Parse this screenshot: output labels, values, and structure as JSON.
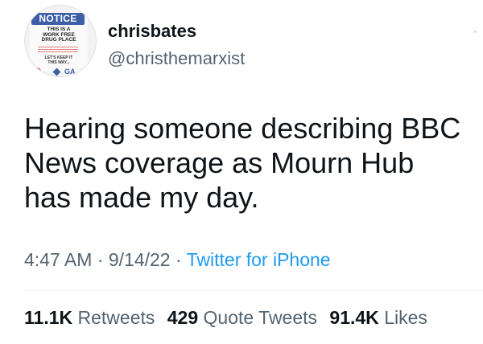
{
  "avatar": {
    "icon": "notice-sign-avatar-icon",
    "sign_title": "NOTICE",
    "sign_lines": [
      "THIS IS A",
      "WORK FREE",
      "DRUG PLACE"
    ],
    "sign_keep": [
      "LET'S KEEP IT",
      "THIS WAY..."
    ],
    "sign_logo_text": "GA"
  },
  "user": {
    "display_name": "chrisbates",
    "handle": "@christhemarxist"
  },
  "tweet": {
    "text": "Hearing someone describing BBC News coverage as Mourn Hub has made my day.",
    "time": "4:47 AM",
    "sep1": " · ",
    "date": "9/14/22",
    "sep2": " · ",
    "source": "Twitter for iPhone"
  },
  "stats": {
    "retweets_count": "11.1K",
    "retweets_label": "Retweets",
    "quotes_count": "429",
    "quotes_label": "Quote Tweets",
    "likes_count": "91.4K",
    "likes_label": "Likes"
  },
  "colors": {
    "text": "#0f1419",
    "muted": "#536471",
    "link": "#1d9bf0",
    "notice_blue": "#3e5fa8"
  }
}
